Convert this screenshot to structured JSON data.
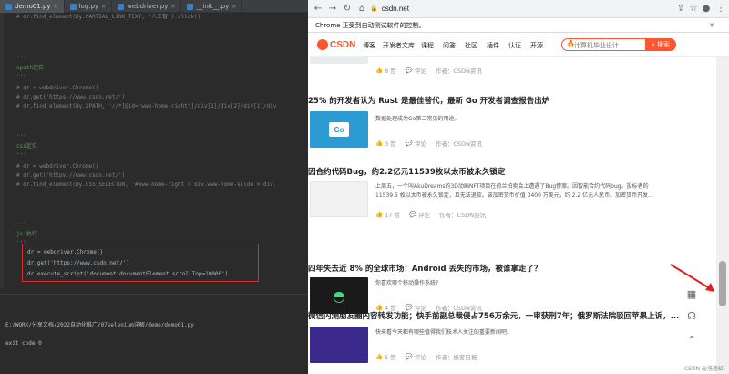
{
  "ide": {
    "tabs": [
      {
        "label": "demo01.py",
        "active": true
      },
      {
        "label": "log.py",
        "active": false
      },
      {
        "label": "webdriver.py",
        "active": false
      },
      {
        "label": "__init__.py",
        "active": false
      }
    ],
    "lines": [
      {
        "cls": "c-comment",
        "text": "# dr.find_element(By.PARTIAL_LINK_TEXT, '人工智').click()"
      },
      {
        "cls": "c-doc",
        "text": "'''"
      },
      {
        "cls": "c-doc",
        "text": "xpath定位"
      },
      {
        "cls": "c-doc",
        "text": "'''"
      },
      {
        "cls": "c-comment",
        "text": "# dr = webdriver.Chrome()"
      },
      {
        "cls": "c-comment",
        "text": "# dr.get('https://www.csdn.net/')"
      },
      {
        "cls": "c-comment",
        "text": "# dr.find_element(By.XPATH, '//*[@id=\"www-home-right\"]/div[1]/div[2]/div[1]/div"
      },
      {
        "cls": "c-doc",
        "text": "'''"
      },
      {
        "cls": "c-doc",
        "text": "css定位"
      },
      {
        "cls": "c-doc",
        "text": "'''"
      },
      {
        "cls": "c-comment",
        "text": "# dr = webdriver.Chrome()"
      },
      {
        "cls": "c-comment",
        "text": "# dr.get('https://www.csdn.net/')"
      },
      {
        "cls": "c-comment",
        "text": "# dr.find_element(By.CSS_SELECTOR, '#www-home-right > div.www-home-silde > div."
      },
      {
        "cls": "c-doc",
        "text": "'''"
      },
      {
        "cls": "c-doc",
        "text": "js 执行"
      },
      {
        "cls": "c-doc",
        "text": "'''"
      },
      {
        "cls": "c-code",
        "text": "dr = webdriver.Chrome()"
      },
      {
        "cls": "c-code",
        "text": "dr.get('https://www.csdn.net/')"
      },
      {
        "cls": "c-code",
        "text": "dr.execute_script('document.documentElement.scrollTop=10000')"
      }
    ],
    "run": {
      "path_line": "E:/WORK/分享文档/2022自动化推广/07selenium详解/demo/demo01.py",
      "exit_line": "exit code 0"
    }
  },
  "browser": {
    "url": "csdn.net",
    "infobar": "Chrome 正受到自动测试软件的控制。",
    "infobar_close": "✕",
    "logo": "CSDN",
    "nav": [
      "博客",
      "开发者文库",
      "课程",
      "问答",
      "社区",
      "插件",
      "认证",
      "开源"
    ],
    "search_placeholder": "计算机毕业设计",
    "search_button": "搜索",
    "articles": [
      {
        "title": "",
        "desc": "",
        "likes": "8 赞",
        "comment": "评论",
        "author": "作者：CSDN资讯",
        "thumb_color": "#e9ecef"
      },
      {
        "title": "25% 的开发者认为 Rust 是最佳替代，最新 Go 开发者调查报告出炉",
        "desc": "数据处理成为Go第二常见的用途。",
        "likes": "3 赞",
        "comment": "评论",
        "author": "作者：CSDN资讯",
        "thumb_color": "#2d9bd3",
        "thumb_label": "Go"
      },
      {
        "title": "因合约代码Bug，约2.2亿元11539枚以太币被永久锁定",
        "desc": "上周五，一个叫AkuDreams的3D动画NFT项目在荷兰拍卖会上遭遇了Bug惨案。因智能合约代码bug，投标者的",
        "desc2": "11539.5 枚以太币被永久锁定，且无法退款。该加密货币价值 3400 万美元，约 2.2 亿元人民币。加密货币开发...",
        "likes": "17 赞",
        "comment": "评论",
        "author": "作者：CSDN资讯",
        "thumb_color": "#f2f2f2"
      },
      {
        "title": "四年失去近 8% 的全球市场：Android 丢失的市场，被谁拿走了？",
        "desc": "你喜欢哪个移动操作系统?",
        "likes": "4 赞",
        "comment": "评论",
        "author": "作者：CSDN资讯",
        "thumb_color": "#1a1a1a"
      },
      {
        "title": "微信内测朋友圈内容转发功能；快手前副总裁侵占756万余元，一审获刑7年；俄罗斯法院驳回苹果上诉，...",
        "desc": "快来看今天都有哪些值得我们技术人关注的重要新闻吧。",
        "likes": "5 赞",
        "comment": "评论",
        "author": "作者：极客日报",
        "thumb_color": "#3b2a8c"
      }
    ],
    "side_tools": [
      "qr-code-icon",
      "headset-icon",
      "back-to-top-icon"
    ],
    "watermark": "CSDN @洛逐虹"
  }
}
